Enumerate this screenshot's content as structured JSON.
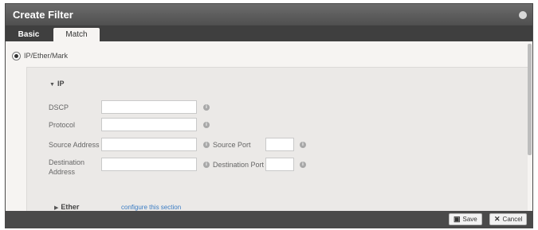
{
  "dialog": {
    "title": "Create Filter",
    "close_icon": "close-circle-icon"
  },
  "tabs": [
    {
      "label": "Basic",
      "active": false
    },
    {
      "label": "Match",
      "active": true
    }
  ],
  "match_type": {
    "selected": true,
    "label": "IP/Ether/Mark"
  },
  "ip_section": {
    "title": "IP",
    "expanded": true,
    "fields": {
      "dscp": {
        "label": "DSCP",
        "value": ""
      },
      "protocol": {
        "label": "Protocol",
        "value": ""
      },
      "source_address": {
        "label": "Source Address",
        "value": ""
      },
      "source_port": {
        "label": "Source Port",
        "value": ""
      },
      "destination_address": {
        "label": "Destination Address",
        "value": ""
      },
      "destination_port": {
        "label": "Destination Port",
        "value": ""
      }
    },
    "info_glyph": "i"
  },
  "ether_section": {
    "title": "Ether",
    "expanded": false,
    "link": "configure this section"
  },
  "footer": {
    "save_label": "Save",
    "save_icon": "disk-icon",
    "cancel_label": "Cancel",
    "cancel_icon": "x-icon"
  },
  "colors": {
    "titlebar": "#5b5b5b",
    "tabstrip": "#3f3f3f",
    "link": "#3b7dc4",
    "content_bg": "#f6f4f2"
  }
}
